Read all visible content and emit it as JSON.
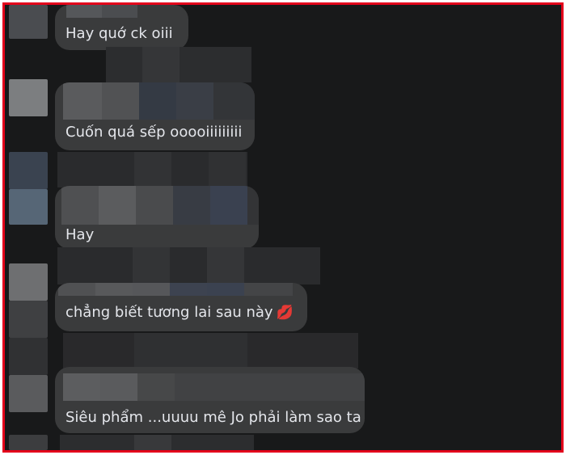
{
  "comments": [
    {
      "text": "Hay quớ ck oiii"
    },
    {
      "text": "Cuốn quá sếp ooooiiiiiiiii"
    },
    {
      "text": "Hay"
    },
    {
      "text": "chẳng biết tương lai sau này",
      "emoji": "💋"
    },
    {
      "text": "Siêu phẩm ...uuuu mê Jo phải làm sao ta"
    }
  ],
  "colors": {
    "background": "#18191a",
    "bubble": "#3a3b3c",
    "text": "#e4e6eb",
    "frame_border": "#e3001b"
  }
}
